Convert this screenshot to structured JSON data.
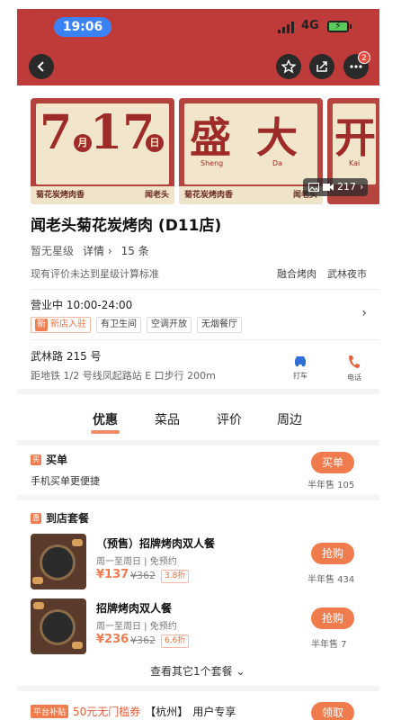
{
  "status_bar": {
    "time": "19:06",
    "network": "4G"
  },
  "nav": {
    "notification_count": "2"
  },
  "banner": {
    "panel1": {
      "month_num": "7",
      "month_char": "月",
      "day_num": "17",
      "day_char": "日",
      "footer_left": "菊花炭烤肉香",
      "footer_right": "闻老头"
    },
    "panel2": {
      "chars": [
        "盛",
        "大"
      ],
      "pinyin": [
        "Sheng",
        "Da"
      ],
      "footer_left": "菊花炭烤肉香",
      "footer_right": "闻老头"
    },
    "panel3": {
      "char": "开",
      "pinyin": "Kai"
    },
    "media_count": "217"
  },
  "shop": {
    "title": "闻老头菊花炭烤肉 (D11店)",
    "rating": "暂无星级",
    "details_label": "详情",
    "review_count": "15 条",
    "rating_note": "现有评价未达到星级计算标准",
    "category": "融合烤肉",
    "area": "武林夜市",
    "hours": "营业中 10:00-24:00",
    "tags": [
      "新店入驻",
      "有卫生间",
      "空调开放",
      "无烟餐厅"
    ],
    "new_box": "新",
    "address": "武林路 215 号",
    "address_sub": "距地铁 1/2 号线凤起路站 E 口步行 200m",
    "taxi_label": "打车",
    "phone_label": "电话"
  },
  "tabs": [
    "优惠",
    "菜品",
    "评价",
    "周边"
  ],
  "pay": {
    "section_icon": "买",
    "section_title": "买单",
    "subtitle": "手机买单更便捷",
    "button": "买单",
    "sold": "半年售 105"
  },
  "package": {
    "section_icon": "惠",
    "section_title": "到店套餐",
    "deals": [
      {
        "name": "（预售）招牌烤肉双人餐",
        "meta": "周一至周日 | 免预约",
        "price": "¥137",
        "old_price": "¥362",
        "discount": "3.8折",
        "button": "抢购",
        "sold": "半年售 434"
      },
      {
        "name": "招牌烤肉双人餐",
        "meta": "周一至周日 | 免预约",
        "price": "¥236",
        "old_price": "¥362",
        "discount": "6.6折",
        "button": "抢购",
        "sold": "半年售 7"
      }
    ],
    "more_link": "查看其它1个套餐"
  },
  "promo": {
    "platform": "平台补贴",
    "amount": "50元无门槛券",
    "city": "【杭州】",
    "note": "用户专享",
    "button": "领取"
  },
  "colors": {
    "header_red": "#bf3b3a",
    "accent_orange": "#f07c4e",
    "status_pill_blue": "#3b82f6"
  }
}
